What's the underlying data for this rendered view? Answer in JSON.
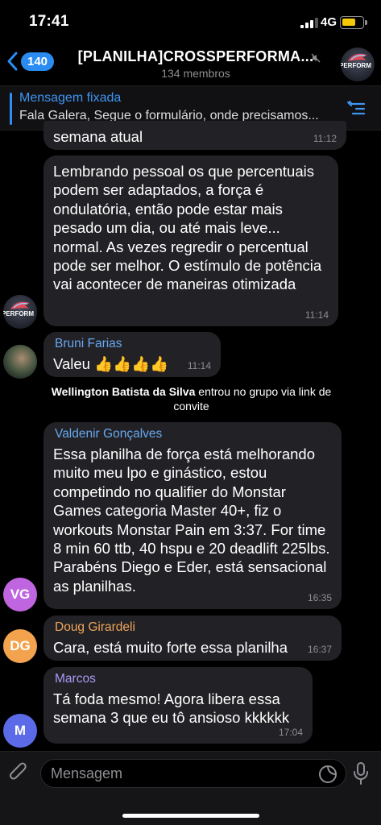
{
  "status": {
    "time": "17:41",
    "network": "4G",
    "battery_level": 0.7,
    "battery_color": "#f6c908"
  },
  "header": {
    "back_count": "140",
    "title": "[PLANILHA]CROSSPERFORMA...",
    "subtitle": "134 membros",
    "avatar_text": "PERFORM",
    "accent": "#2a8cf0"
  },
  "pinned": {
    "label": "Mensagem fixada",
    "text": "Fala Galera, Segue o formulário, onde precisamos..."
  },
  "messages": [
    {
      "text": "semana atual",
      "time": "11:12"
    },
    {
      "text": "Lembrando pessoal os que percentuais podem ser adaptados, a força é ondulatória,  então pode estar mais pesado um dia, ou até mais leve... normal.  As vezes regredir o percentual pode ser melhor.  O estímulo de potência vai acontecer de maneiras otimizada",
      "time": "11:14",
      "avatar_text": "PERFORM"
    },
    {
      "sender": "Bruni Farias",
      "sender_color": "#68a8f0",
      "text": "Valeu 👍👍👍👍",
      "time": "11:14"
    },
    {
      "sender": "Valdenir Gonçalves",
      "sender_color": "#68a8f0",
      "text": "Essa planilha de força está melhorando muito meu lpo e ginástico, estou competindo no qualifier do Monstar Games categoria Master 40+, fiz o workouts Monstar Pain em 3:37. For time 8 min 60 ttb, 40 hspu e 20 deadlift 225lbs. Parabéns Diego e Eder, está sensacional as planilhas.",
      "time": "16:35",
      "avatar_initials": "VG",
      "avatar_color": "#c065e0"
    },
    {
      "sender": "Doug Girardeli",
      "sender_color": "#f0a45a",
      "text": "Cara, está muito forte essa planilha",
      "time": "16:37",
      "avatar_initials": "DG",
      "avatar_color": "#f3a24d"
    },
    {
      "sender": "Marcos",
      "sender_color": "#a99af5",
      "text": "Tá foda mesmo! Agora libera essa semana 3 que eu tô ansioso kkkkkk",
      "time": "17:04",
      "avatar_initials": "M",
      "avatar_color": "#5b6be8"
    }
  ],
  "system_message": {
    "name": "Wellington Batista da Silva",
    "text": " entrou no grupo via link de convite"
  },
  "input": {
    "placeholder": "Mensagem"
  }
}
